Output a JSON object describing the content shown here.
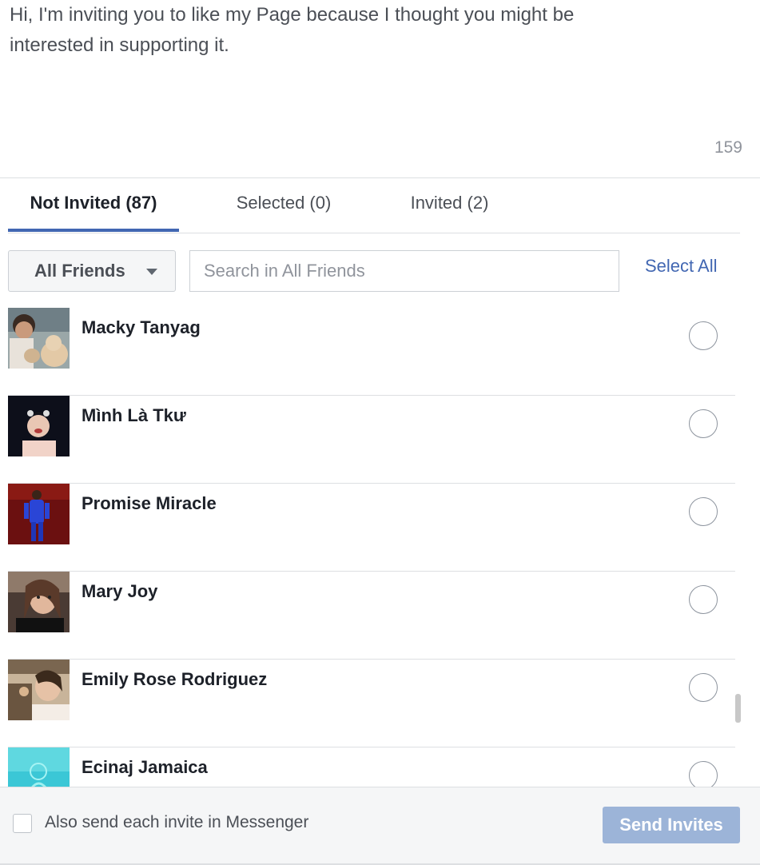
{
  "message": {
    "text": "Hi, I'm inviting you to like my Page because I thought you might be\ninterested in supporting it.",
    "char_count": "159"
  },
  "tabs": [
    {
      "label": "Not Invited (87)",
      "active": true
    },
    {
      "label": "Selected (0)",
      "active": false
    },
    {
      "label": "Invited (2)",
      "active": false
    }
  ],
  "filter": {
    "dropdown_label": "All Friends",
    "search_placeholder": "Search in All Friends",
    "select_all_label": "Select All"
  },
  "friends": [
    {
      "name": "Macky Tanyag"
    },
    {
      "name": "Mình Là Tkư"
    },
    {
      "name": "Promise Miracle"
    },
    {
      "name": "Mary Joy"
    },
    {
      "name": "Emily Rose Rodriguez"
    },
    {
      "name": "Ecinaj Jamaica"
    }
  ],
  "footer": {
    "messenger_label": "Also send each invite in Messenger",
    "send_label": "Send Invites"
  },
  "colors": {
    "accent": "#4267b2",
    "send_disabled": "#9cb4d8"
  }
}
